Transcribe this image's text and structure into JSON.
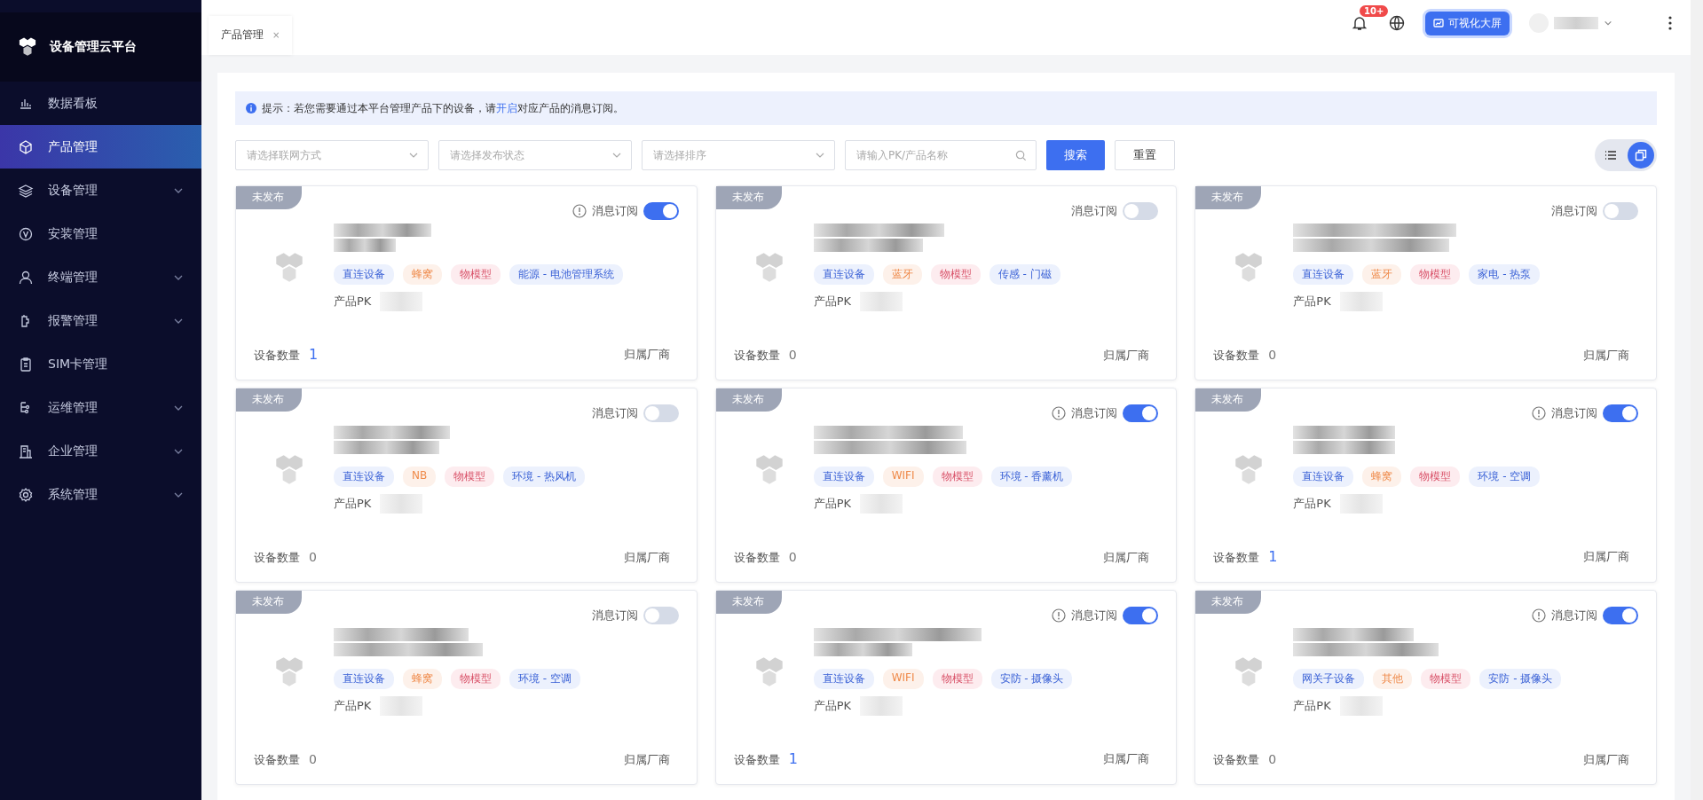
{
  "sidebar": {
    "title": "设备管理云平台",
    "items": [
      {
        "label": "数据看板",
        "selected": false,
        "expandable": false
      },
      {
        "label": "产品管理",
        "selected": true,
        "expandable": false
      },
      {
        "label": "设备管理",
        "selected": false,
        "expandable": true
      },
      {
        "label": "安装管理",
        "selected": false,
        "expandable": false
      },
      {
        "label": "终端管理",
        "selected": false,
        "expandable": true
      },
      {
        "label": "报警管理",
        "selected": false,
        "expandable": true
      },
      {
        "label": "SIM卡管理",
        "selected": false,
        "expandable": false
      },
      {
        "label": "运维管理",
        "selected": false,
        "expandable": true
      },
      {
        "label": "企业管理",
        "selected": false,
        "expandable": true
      },
      {
        "label": "系统管理",
        "selected": false,
        "expandable": true
      }
    ]
  },
  "header": {
    "tabs": [
      {
        "label": "产品管理",
        "close": "×",
        "selected": true
      }
    ],
    "notification_badge": "10+",
    "big_screen_button": "可视化大屏"
  },
  "notice": {
    "text": "提示：若您需要通过本平台管理产品下的设备，请",
    "link": "开启",
    "rest": "对应产品的消息订阅。"
  },
  "filters": {
    "selects": [
      {
        "placeholder": "请选择联网方式"
      },
      {
        "placeholder": "请选择发布状态"
      },
      {
        "placeholder": "请选择排序"
      }
    ],
    "search": {
      "placeholder": "请输入PK/产品名称"
    },
    "search_button": "搜索",
    "reset_button": "重置",
    "views": [
      {
        "kind": "list",
        "selected": false
      },
      {
        "kind": "card",
        "selected": true
      }
    ]
  },
  "products": [
    {
      "status": "未发布",
      "subscription_label": "消息订阅",
      "subscribed": true,
      "tags": [
        {
          "kind": "connect",
          "label": "直连设备"
        },
        {
          "kind": "network",
          "label": "蜂窝"
        },
        {
          "kind": "model",
          "label": "物模型"
        },
        {
          "kind": "category",
          "label": "能源 - 电池管理系统"
        }
      ],
      "pk_label": "产品PK",
      "count_label": "设备数量",
      "count": "1",
      "vendor_label": "归属厂商"
    },
    {
      "status": "未发布",
      "subscription_label": "消息订阅",
      "subscribed": false,
      "tags": [
        {
          "kind": "connect",
          "label": "直连设备"
        },
        {
          "kind": "network",
          "label": "蓝牙"
        },
        {
          "kind": "model",
          "label": "物模型"
        },
        {
          "kind": "category",
          "label": "传感 - 门磁"
        }
      ],
      "pk_label": "产品PK",
      "count_label": "设备数量",
      "count": "0",
      "vendor_label": "归属厂商"
    },
    {
      "status": "未发布",
      "subscription_label": "消息订阅",
      "subscribed": false,
      "tags": [
        {
          "kind": "connect",
          "label": "直连设备"
        },
        {
          "kind": "network",
          "label": "蓝牙"
        },
        {
          "kind": "model",
          "label": "物模型"
        },
        {
          "kind": "category",
          "label": "家电 - 热泵"
        }
      ],
      "pk_label": "产品PK",
      "count_label": "设备数量",
      "count": "0",
      "vendor_label": "归属厂商"
    },
    {
      "status": "未发布",
      "subscription_label": "消息订阅",
      "subscribed": false,
      "tags": [
        {
          "kind": "connect",
          "label": "直连设备"
        },
        {
          "kind": "network",
          "label": "NB"
        },
        {
          "kind": "model",
          "label": "物模型"
        },
        {
          "kind": "category",
          "label": "环境 - 热风机"
        }
      ],
      "pk_label": "产品PK",
      "count_label": "设备数量",
      "count": "0",
      "vendor_label": "归属厂商"
    },
    {
      "status": "未发布",
      "subscription_label": "消息订阅",
      "subscribed": true,
      "tags": [
        {
          "kind": "connect",
          "label": "直连设备"
        },
        {
          "kind": "network",
          "label": "WIFI"
        },
        {
          "kind": "model",
          "label": "物模型"
        },
        {
          "kind": "category",
          "label": "环境 - 香薰机"
        }
      ],
      "pk_label": "产品PK",
      "count_label": "设备数量",
      "count": "0",
      "vendor_label": "归属厂商"
    },
    {
      "status": "未发布",
      "subscription_label": "消息订阅",
      "subscribed": true,
      "tags": [
        {
          "kind": "connect",
          "label": "直连设备"
        },
        {
          "kind": "network",
          "label": "蜂窝"
        },
        {
          "kind": "model",
          "label": "物模型"
        },
        {
          "kind": "category",
          "label": "环境 - 空调"
        }
      ],
      "pk_label": "产品PK",
      "count_label": "设备数量",
      "count": "1",
      "vendor_label": "归属厂商"
    },
    {
      "status": "未发布",
      "subscription_label": "消息订阅",
      "subscribed": false,
      "tags": [
        {
          "kind": "connect",
          "label": "直连设备"
        },
        {
          "kind": "network",
          "label": "蜂窝"
        },
        {
          "kind": "model",
          "label": "物模型"
        },
        {
          "kind": "category",
          "label": "环境 - 空调"
        }
      ],
      "pk_label": "产品PK",
      "count_label": "设备数量",
      "count": "0",
      "vendor_label": "归属厂商"
    },
    {
      "status": "未发布",
      "subscription_label": "消息订阅",
      "subscribed": true,
      "tags": [
        {
          "kind": "connect",
          "label": "直连设备"
        },
        {
          "kind": "network",
          "label": "WIFI"
        },
        {
          "kind": "model",
          "label": "物模型"
        },
        {
          "kind": "category",
          "label": "安防 - 摄像头"
        }
      ],
      "pk_label": "产品PK",
      "count_label": "设备数量",
      "count": "1",
      "vendor_label": "归属厂商"
    },
    {
      "status": "未发布",
      "subscription_label": "消息订阅",
      "subscribed": true,
      "tags": [
        {
          "kind": "connect",
          "label": "网关子设备"
        },
        {
          "kind": "network",
          "label": "其他"
        },
        {
          "kind": "model",
          "label": "物模型"
        },
        {
          "kind": "category",
          "label": "安防 - 摄像头"
        }
      ],
      "pk_label": "产品PK",
      "count_label": "设备数量",
      "count": "0",
      "vendor_label": "归属厂商"
    }
  ]
}
